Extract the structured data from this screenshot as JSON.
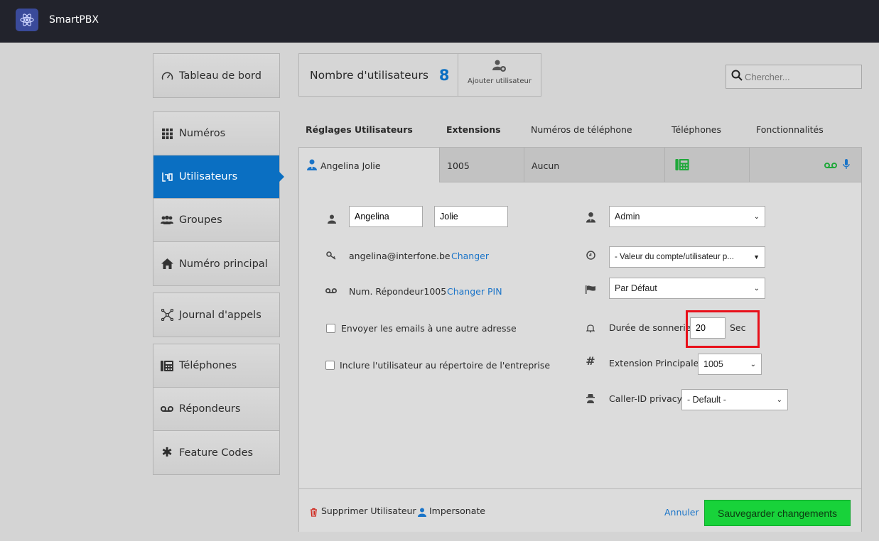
{
  "app": {
    "name": "SmartPBX"
  },
  "nav": {
    "dashboard": "Tableau de bord",
    "numbers": "Numéros",
    "users": "Utilisateurs",
    "groups": "Groupes",
    "main_number": "Numéro principal",
    "call_log": "Journal d'appels",
    "phones": "Téléphones",
    "voicemails": "Répondeurs",
    "feature_codes": "Feature Codes"
  },
  "header": {
    "users_count_label": "Nombre d'utilisateurs",
    "users_count": "8",
    "add_user_label": "Ajouter utilisateur",
    "search_placeholder": "Chercher..."
  },
  "tabs": {
    "settings": "Réglages Utilisateurs",
    "extensions": "Extensions",
    "phone_numbers": "Numéros de téléphone",
    "phones": "Téléphones",
    "features": "Fonctionnalités"
  },
  "user_row": {
    "name": "Angelina Jolie",
    "extension": "1005",
    "number": "Aucun"
  },
  "form": {
    "first_name": "Angelina",
    "last_name": "Jolie",
    "email": "angelina@interfone.be",
    "change_label": "Changer",
    "voicemail_label": "Num. Répondeur1005",
    "change_pin_label": "Changer PIN",
    "send_emails_label": "Envoyer les emails à une autre adresse",
    "include_directory_label": "Inclure l'utilisateur au répertoire de l'entreprise",
    "role_value": "Admin",
    "timezone_value": "- Valeur du compte/utilisateur p...",
    "music_value": "Par Défaut",
    "ring_duration_label": "Durée de sonnerie",
    "ring_duration_value": "20",
    "ring_unit": "Sec",
    "main_extension_label": "Extension Principale",
    "main_extension_value": "1005",
    "caller_id_label": "Caller-ID privacy",
    "caller_id_value": "- Default -"
  },
  "footer": {
    "delete_label": "Supprimer Utilisateur",
    "impersonate_label": "Impersonate",
    "cancel_label": "Annuler",
    "save_label": "Sauvegarder changements"
  },
  "colors": {
    "accent": "#0a6fc2",
    "save_button": "#18d23a",
    "highlight": "#e8101a",
    "topbar": "#22232c"
  }
}
